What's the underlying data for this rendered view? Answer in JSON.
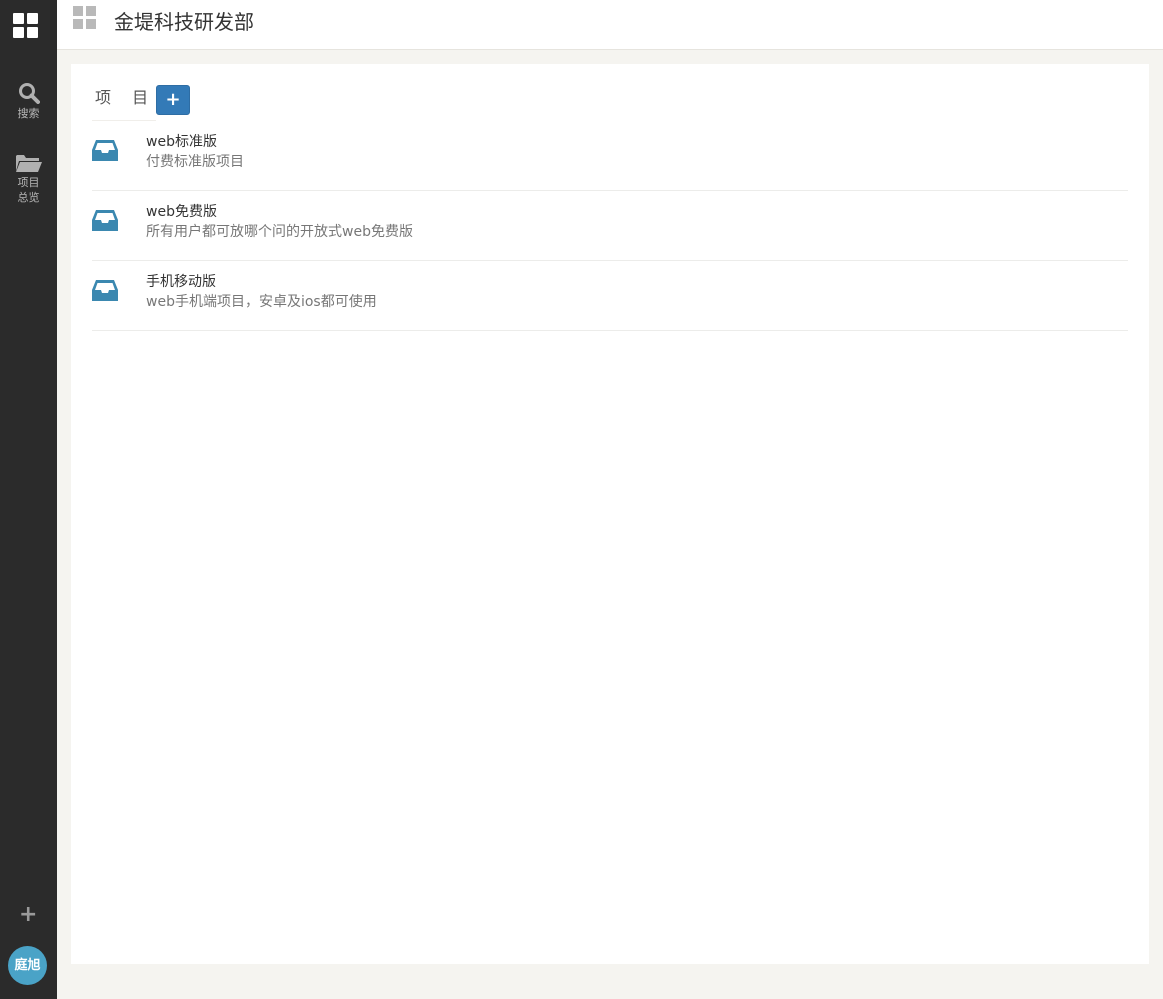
{
  "app": {
    "title": "金堤科技研发部"
  },
  "sidebar": {
    "search_label": "搜索",
    "projects_label": "项目总览",
    "avatar_text": "庭旭"
  },
  "main": {
    "section_title": "项 目",
    "add_button": "+",
    "projects": [
      {
        "name": "web标准版",
        "desc": "付费标准版项目"
      },
      {
        "name": "web免费版",
        "desc": "所有用户都可放哪个问的开放式web免费版"
      },
      {
        "name": "手机移动版",
        "desc": "web手机端项目，安卓及ios都可使用"
      }
    ]
  },
  "colors": {
    "sidebar_bg": "#2b2b2b",
    "accent": "#337ab7",
    "project_icon": "#3b88b0",
    "avatar": "#4aa3c7"
  },
  "icons": [
    "dashboard-icon",
    "search-icon",
    "folder-open-icon",
    "plus-icon",
    "inbox-icon",
    "grid-icon"
  ]
}
